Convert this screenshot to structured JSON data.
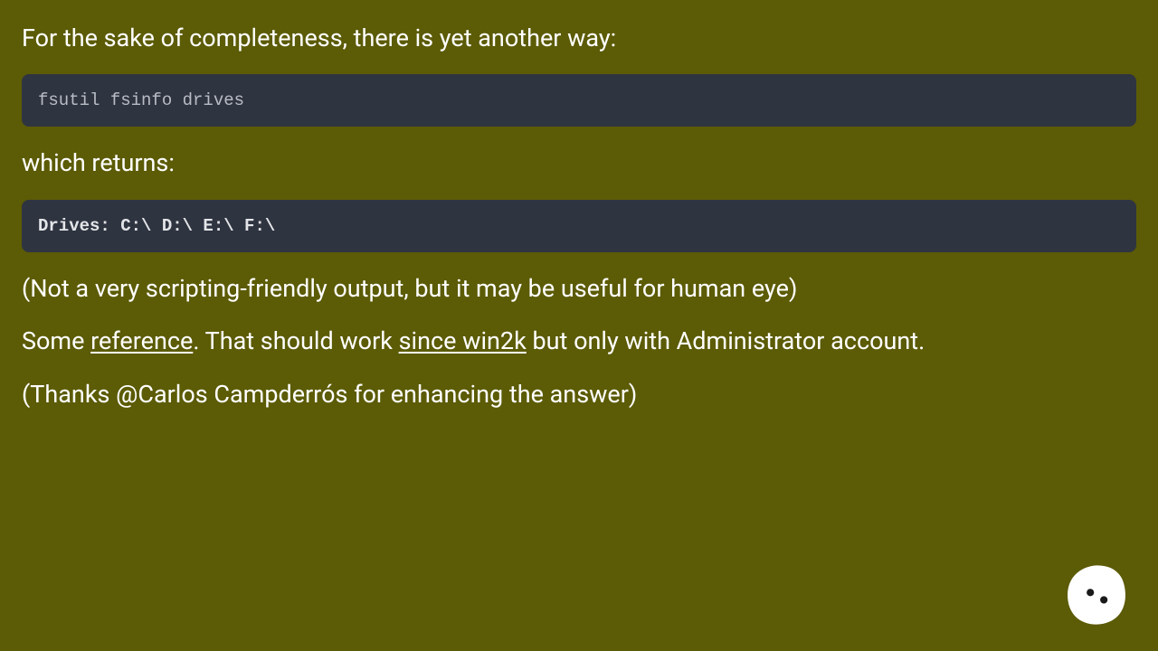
{
  "p1": "For the sake of completeness, there is yet another way:",
  "code1": "fsutil fsinfo drives",
  "p2": "which returns:",
  "code2": "Drives: C:\\ D:\\ E:\\ F:\\",
  "p3": "(Not a very scripting-friendly output, but it may be useful for human eye)",
  "p4_pre": "Some ",
  "p4_link1": "reference",
  "p4_mid": ". That should work ",
  "p4_link2": "since win2k",
  "p4_post": " but only with Administrator account.",
  "p5": "(Thanks @Carlos Campderrós for enhancing the answer)"
}
